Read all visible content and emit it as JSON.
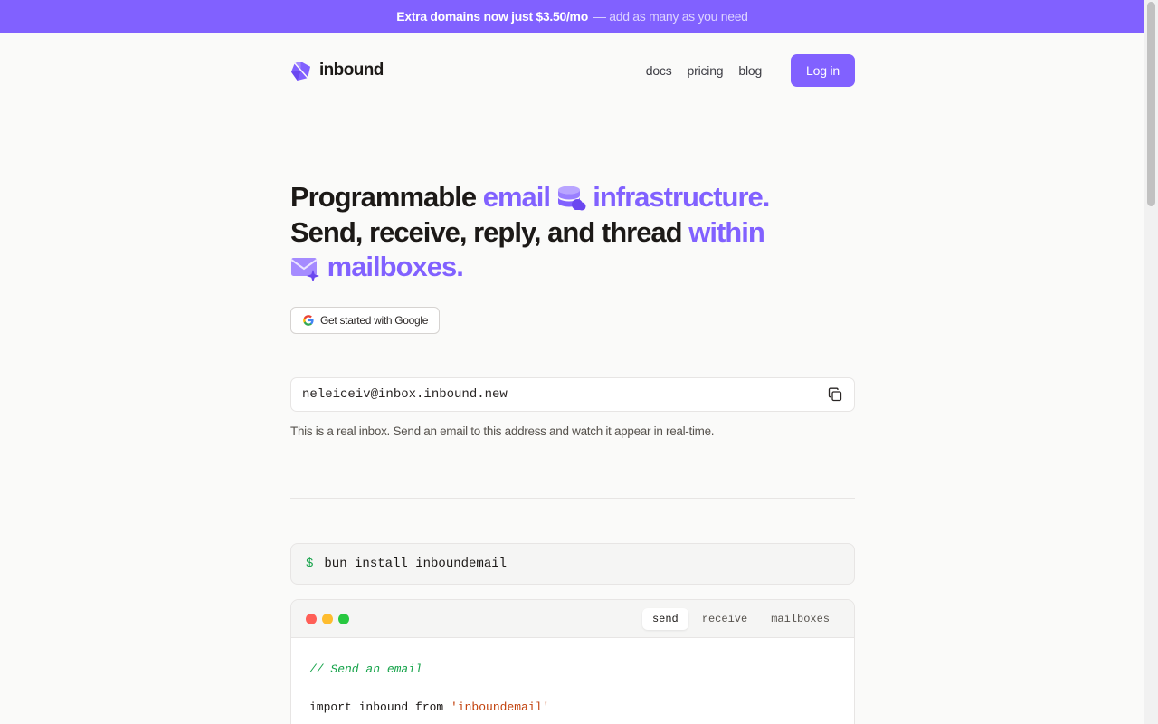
{
  "banner": {
    "highlight": "Extra domains now just $3.50/mo",
    "rest": "— add as many as you need"
  },
  "nav": {
    "brand": "inbound",
    "links": [
      "docs",
      "pricing",
      "blog"
    ],
    "login_label": "Log in"
  },
  "hero": {
    "part1": "Programmable ",
    "accent1": "email",
    "accent2": "infrastructure.",
    "part2": "Send, receive, reply, and thread ",
    "accent3": "within",
    "accent4": "mailboxes."
  },
  "cta": {
    "google_label": "Get started with Google"
  },
  "inbox": {
    "address": "neleiceiv@inbox.inbound.new",
    "help": "This is a real inbox. Send an email to this address and watch it appear in real-time."
  },
  "install": {
    "prompt": "$",
    "command": "bun install inboundemail"
  },
  "code": {
    "tabs": [
      "send",
      "receive",
      "mailboxes"
    ],
    "active_tab": "send",
    "comment": "// Send an email",
    "import_kw": "import inbound from ",
    "import_str": "'inboundemail'"
  },
  "colors": {
    "accent": "#8161ff",
    "traffic_red": "#ff5f57",
    "traffic_yellow": "#febc2e",
    "traffic_green": "#28c840"
  }
}
